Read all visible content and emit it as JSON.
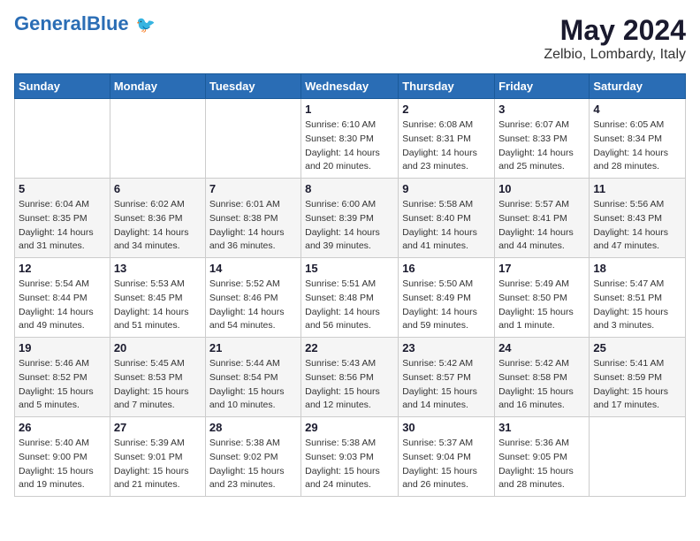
{
  "header": {
    "logo_general": "General",
    "logo_blue": "Blue",
    "month_title": "May 2024",
    "subtitle": "Zelbio, Lombardy, Italy"
  },
  "days_of_week": [
    "Sunday",
    "Monday",
    "Tuesday",
    "Wednesday",
    "Thursday",
    "Friday",
    "Saturday"
  ],
  "weeks": [
    [
      {
        "day": "",
        "info": ""
      },
      {
        "day": "",
        "info": ""
      },
      {
        "day": "",
        "info": ""
      },
      {
        "day": "1",
        "info": "Sunrise: 6:10 AM\nSunset: 8:30 PM\nDaylight: 14 hours\nand 20 minutes."
      },
      {
        "day": "2",
        "info": "Sunrise: 6:08 AM\nSunset: 8:31 PM\nDaylight: 14 hours\nand 23 minutes."
      },
      {
        "day": "3",
        "info": "Sunrise: 6:07 AM\nSunset: 8:33 PM\nDaylight: 14 hours\nand 25 minutes."
      },
      {
        "day": "4",
        "info": "Sunrise: 6:05 AM\nSunset: 8:34 PM\nDaylight: 14 hours\nand 28 minutes."
      }
    ],
    [
      {
        "day": "5",
        "info": "Sunrise: 6:04 AM\nSunset: 8:35 PM\nDaylight: 14 hours\nand 31 minutes."
      },
      {
        "day": "6",
        "info": "Sunrise: 6:02 AM\nSunset: 8:36 PM\nDaylight: 14 hours\nand 34 minutes."
      },
      {
        "day": "7",
        "info": "Sunrise: 6:01 AM\nSunset: 8:38 PM\nDaylight: 14 hours\nand 36 minutes."
      },
      {
        "day": "8",
        "info": "Sunrise: 6:00 AM\nSunset: 8:39 PM\nDaylight: 14 hours\nand 39 minutes."
      },
      {
        "day": "9",
        "info": "Sunrise: 5:58 AM\nSunset: 8:40 PM\nDaylight: 14 hours\nand 41 minutes."
      },
      {
        "day": "10",
        "info": "Sunrise: 5:57 AM\nSunset: 8:41 PM\nDaylight: 14 hours\nand 44 minutes."
      },
      {
        "day": "11",
        "info": "Sunrise: 5:56 AM\nSunset: 8:43 PM\nDaylight: 14 hours\nand 47 minutes."
      }
    ],
    [
      {
        "day": "12",
        "info": "Sunrise: 5:54 AM\nSunset: 8:44 PM\nDaylight: 14 hours\nand 49 minutes."
      },
      {
        "day": "13",
        "info": "Sunrise: 5:53 AM\nSunset: 8:45 PM\nDaylight: 14 hours\nand 51 minutes."
      },
      {
        "day": "14",
        "info": "Sunrise: 5:52 AM\nSunset: 8:46 PM\nDaylight: 14 hours\nand 54 minutes."
      },
      {
        "day": "15",
        "info": "Sunrise: 5:51 AM\nSunset: 8:48 PM\nDaylight: 14 hours\nand 56 minutes."
      },
      {
        "day": "16",
        "info": "Sunrise: 5:50 AM\nSunset: 8:49 PM\nDaylight: 14 hours\nand 59 minutes."
      },
      {
        "day": "17",
        "info": "Sunrise: 5:49 AM\nSunset: 8:50 PM\nDaylight: 15 hours\nand 1 minute."
      },
      {
        "day": "18",
        "info": "Sunrise: 5:47 AM\nSunset: 8:51 PM\nDaylight: 15 hours\nand 3 minutes."
      }
    ],
    [
      {
        "day": "19",
        "info": "Sunrise: 5:46 AM\nSunset: 8:52 PM\nDaylight: 15 hours\nand 5 minutes."
      },
      {
        "day": "20",
        "info": "Sunrise: 5:45 AM\nSunset: 8:53 PM\nDaylight: 15 hours\nand 7 minutes."
      },
      {
        "day": "21",
        "info": "Sunrise: 5:44 AM\nSunset: 8:54 PM\nDaylight: 15 hours\nand 10 minutes."
      },
      {
        "day": "22",
        "info": "Sunrise: 5:43 AM\nSunset: 8:56 PM\nDaylight: 15 hours\nand 12 minutes."
      },
      {
        "day": "23",
        "info": "Sunrise: 5:42 AM\nSunset: 8:57 PM\nDaylight: 15 hours\nand 14 minutes."
      },
      {
        "day": "24",
        "info": "Sunrise: 5:42 AM\nSunset: 8:58 PM\nDaylight: 15 hours\nand 16 minutes."
      },
      {
        "day": "25",
        "info": "Sunrise: 5:41 AM\nSunset: 8:59 PM\nDaylight: 15 hours\nand 17 minutes."
      }
    ],
    [
      {
        "day": "26",
        "info": "Sunrise: 5:40 AM\nSunset: 9:00 PM\nDaylight: 15 hours\nand 19 minutes."
      },
      {
        "day": "27",
        "info": "Sunrise: 5:39 AM\nSunset: 9:01 PM\nDaylight: 15 hours\nand 21 minutes."
      },
      {
        "day": "28",
        "info": "Sunrise: 5:38 AM\nSunset: 9:02 PM\nDaylight: 15 hours\nand 23 minutes."
      },
      {
        "day": "29",
        "info": "Sunrise: 5:38 AM\nSunset: 9:03 PM\nDaylight: 15 hours\nand 24 minutes."
      },
      {
        "day": "30",
        "info": "Sunrise: 5:37 AM\nSunset: 9:04 PM\nDaylight: 15 hours\nand 26 minutes."
      },
      {
        "day": "31",
        "info": "Sunrise: 5:36 AM\nSunset: 9:05 PM\nDaylight: 15 hours\nand 28 minutes."
      },
      {
        "day": "",
        "info": ""
      }
    ]
  ]
}
